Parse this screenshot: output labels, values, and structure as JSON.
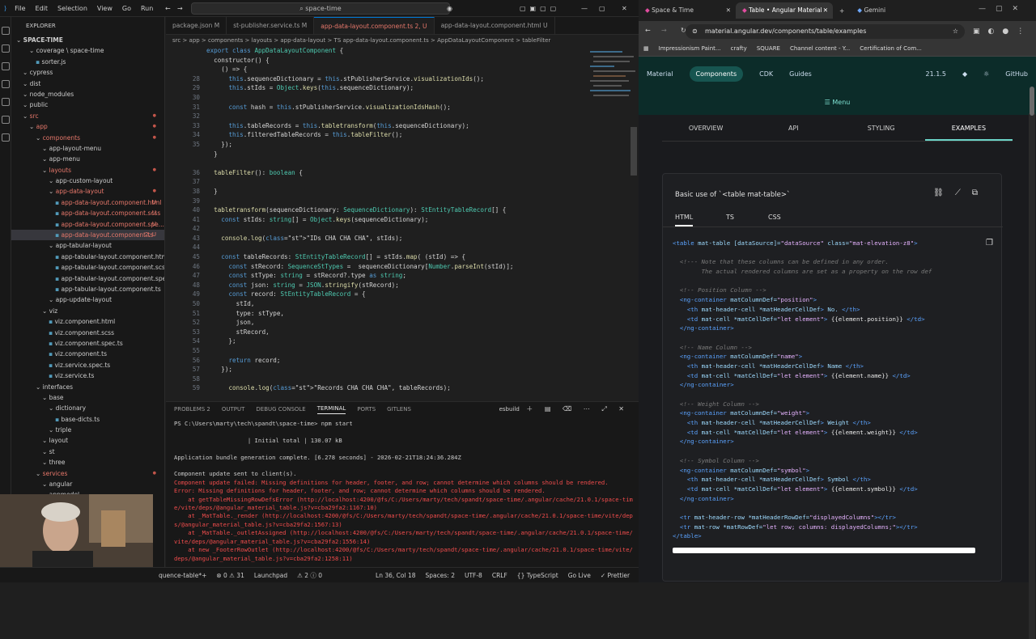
{
  "vscode": {
    "menu": [
      "File",
      "Edit",
      "Selection",
      "View",
      "Go",
      "Run"
    ],
    "search": "space-time",
    "explorer_title": "EXPLORER",
    "tree": [
      {
        "label": "SPACE-TIME",
        "indent": 0,
        "type": "root"
      },
      {
        "label": "coverage \\ space-time",
        "indent": 2,
        "type": "folder"
      },
      {
        "label": "sorter.js",
        "indent": 3,
        "type": "file"
      },
      {
        "label": "cypress",
        "indent": 1,
        "type": "folder"
      },
      {
        "label": "dist",
        "indent": 1,
        "type": "folder"
      },
      {
        "label": "node_modules",
        "indent": 1,
        "type": "folder"
      },
      {
        "label": "public",
        "indent": 1,
        "type": "folder"
      },
      {
        "label": "src",
        "indent": 1,
        "type": "folder",
        "color": "red"
      },
      {
        "label": "app",
        "indent": 2,
        "type": "folder",
        "color": "red"
      },
      {
        "label": "components",
        "indent": 3,
        "type": "folder",
        "color": "red"
      },
      {
        "label": "app-layout-menu",
        "indent": 4,
        "type": "folder"
      },
      {
        "label": "app-menu",
        "indent": 4,
        "type": "folder"
      },
      {
        "label": "layouts",
        "indent": 4,
        "type": "folder",
        "color": "red"
      },
      {
        "label": "app-custom-layout",
        "indent": 5,
        "type": "folder"
      },
      {
        "label": "app-data-layout",
        "indent": 5,
        "type": "folder",
        "color": "red"
      },
      {
        "label": "app-data-layout.component.html",
        "indent": 6,
        "type": "file",
        "color": "red",
        "badge": "U"
      },
      {
        "label": "app-data-layout.component.scss",
        "indent": 6,
        "type": "file",
        "color": "red",
        "badge": "U"
      },
      {
        "label": "app-data-layout.component.spe...",
        "indent": 6,
        "type": "file",
        "color": "red",
        "badge": "U"
      },
      {
        "label": "app-data-layout.component.ts",
        "indent": 6,
        "type": "file",
        "color": "red",
        "badge": "2, U",
        "selected": true
      },
      {
        "label": "app-tabular-layout",
        "indent": 5,
        "type": "folder"
      },
      {
        "label": "app-tabular-layout.component.html",
        "indent": 6,
        "type": "file"
      },
      {
        "label": "app-tabular-layout.component.scss",
        "indent": 6,
        "type": "file"
      },
      {
        "label": "app-tabular-layout.component.spec.ts",
        "indent": 6,
        "type": "file"
      },
      {
        "label": "app-tabular-layout.component.ts",
        "indent": 6,
        "type": "file"
      },
      {
        "label": "app-update-layout",
        "indent": 5,
        "type": "folder"
      },
      {
        "label": "viz",
        "indent": 4,
        "type": "folder"
      },
      {
        "label": "viz.component.html",
        "indent": 5,
        "type": "file"
      },
      {
        "label": "viz.component.scss",
        "indent": 5,
        "type": "file"
      },
      {
        "label": "viz.component.spec.ts",
        "indent": 5,
        "type": "file"
      },
      {
        "label": "viz.component.ts",
        "indent": 5,
        "type": "file"
      },
      {
        "label": "viz.service.spec.ts",
        "indent": 5,
        "type": "file"
      },
      {
        "label": "viz.service.ts",
        "indent": 5,
        "type": "file"
      },
      {
        "label": "interfaces",
        "indent": 3,
        "type": "folder"
      },
      {
        "label": "base",
        "indent": 4,
        "type": "folder"
      },
      {
        "label": "dictionary",
        "indent": 5,
        "type": "folder"
      },
      {
        "label": "base-dicts.ts",
        "indent": 6,
        "type": "file"
      },
      {
        "label": "triple",
        "indent": 5,
        "type": "folder"
      },
      {
        "label": "layout",
        "indent": 4,
        "type": "folder"
      },
      {
        "label": "st",
        "indent": 4,
        "type": "folder"
      },
      {
        "label": "three",
        "indent": 4,
        "type": "folder"
      },
      {
        "label": "services",
        "indent": 3,
        "type": "folder",
        "color": "red"
      },
      {
        "label": "angular",
        "indent": 4,
        "type": "folder"
      },
      {
        "label": "appmodel",
        "indent": 4,
        "type": "folder"
      }
    ],
    "tabs": [
      {
        "label": "package.json M",
        "active": false
      },
      {
        "label": "st-publisher.service.ts M",
        "active": false
      },
      {
        "label": "app-data-layout.component.ts 2, U",
        "active": true
      },
      {
        "label": "app-data-layout.component.html U",
        "active": false
      }
    ],
    "breadcrumb": "src > app > components > layouts > app-data-layout > TS app-data-layout.component.ts > AppDataLayoutComponent > tableFilter",
    "code": [
      {
        "n": "",
        "t": "export class AppDataLayoutComponent {"
      },
      {
        "n": "",
        "t": "  constructor() {"
      },
      {
        "n": "",
        "t": "    () => {"
      },
      {
        "n": "28",
        "t": "      this.sequenceDictionary = this.stPublisherService.visualizationIds();"
      },
      {
        "n": "29",
        "t": "      this.stIds = Object.keys(this.sequenceDictionary);"
      },
      {
        "n": "30",
        "t": ""
      },
      {
        "n": "31",
        "t": "      const hash = this.stPublisherService.visualizationIdsHash();"
      },
      {
        "n": "32",
        "t": ""
      },
      {
        "n": "33",
        "t": "      this.tableRecords = this.tabletransform(this.sequenceDictionary);"
      },
      {
        "n": "34",
        "t": "      this.filteredTableRecords = this.tableFilter();"
      },
      {
        "n": "35",
        "t": "    });"
      },
      {
        "n": "",
        "t": "  }"
      },
      {
        "n": "",
        "t": ""
      },
      {
        "n": "36",
        "t": "  tableFilter(): boolean {"
      },
      {
        "n": "37",
        "t": ""
      },
      {
        "n": "38",
        "t": "  }"
      },
      {
        "n": "39",
        "t": ""
      },
      {
        "n": "40",
        "t": "  tabletransform(sequenceDictionary: SequenceDictionary): StEntityTableRecord[] {"
      },
      {
        "n": "41",
        "t": "    const stIds: string[] = Object.keys(sequenceDictionary);"
      },
      {
        "n": "42",
        "t": ""
      },
      {
        "n": "43",
        "t": "    console.log(\"IDs CHA CHA CHA\", stIds);"
      },
      {
        "n": "44",
        "t": ""
      },
      {
        "n": "45",
        "t": "    const tableRecords: StEntityTableRecord[] = stIds.map( (stId) => {"
      },
      {
        "n": "46",
        "t": "      const stRecord: SequenceStTypes =  sequenceDictionary[Number.parseInt(stId)];"
      },
      {
        "n": "47",
        "t": "      const stType: string = stRecord?.type as string;"
      },
      {
        "n": "48",
        "t": "      const json: string = JSON.stringify(stRecord);"
      },
      {
        "n": "49",
        "t": "      const record: StEntityTableRecord = {"
      },
      {
        "n": "50",
        "t": "        stId,"
      },
      {
        "n": "51",
        "t": "        type: stType,"
      },
      {
        "n": "52",
        "t": "        json,"
      },
      {
        "n": "53",
        "t": "        stRecord,"
      },
      {
        "n": "54",
        "t": "      };"
      },
      {
        "n": "55",
        "t": ""
      },
      {
        "n": "56",
        "t": "      return record;"
      },
      {
        "n": "57",
        "t": "    });"
      },
      {
        "n": "58",
        "t": ""
      },
      {
        "n": "59",
        "t": "      console.log(\"Records CHA CHA CHA\", tableRecords);"
      }
    ],
    "panel_tabs": [
      "PROBLEMS 2",
      "OUTPUT",
      "DEBUG CONSOLE",
      "TERMINAL",
      "PORTS",
      "GITLENS"
    ],
    "panel_active": "TERMINAL",
    "terminal_name": "esbuild",
    "terminal": [
      {
        "t": "PS C:\\Users\\marty\\tech\\spandt\\space-time> npm start",
        "c": "norm"
      },
      {
        "t": "",
        "c": "norm"
      },
      {
        "t": "                     | Initial total | 130.07 kB",
        "c": "norm"
      },
      {
        "t": "",
        "c": "norm"
      },
      {
        "t": "Application bundle generation complete. [6.278 seconds] - 2026-02-21T18:24:36.284Z",
        "c": "norm"
      },
      {
        "t": "",
        "c": "norm"
      },
      {
        "t": "Component update sent to client(s).",
        "c": "norm"
      },
      {
        "t": "Component update failed: Missing definitions for header, footer, and row; cannot determine which columns should be rendered.",
        "c": "err"
      },
      {
        "t": "Error: Missing definitions for header, footer, and row; cannot determine which columns should be rendered.",
        "c": "err"
      },
      {
        "t": "    at getTableMissingRowDefsError (http://localhost:4200/@fs/C:/Users/marty/tech/spandt/space-time/.angular/cache/21.0.1/space-tim",
        "c": "err"
      },
      {
        "t": "e/vite/deps/@angular_material_table.js?v=cba29fa2:1167:10)",
        "c": "err"
      },
      {
        "t": "    at _MatTable._render (http://localhost:4200/@fs/C:/Users/marty/tech/spandt/space-time/.angular/cache/21.0.1/space-time/vite/dep",
        "c": "err"
      },
      {
        "t": "s/@angular_material_table.js?v=cba29fa2:1567:13)",
        "c": "err"
      },
      {
        "t": "    at _MatTable._outletAssigned (http://localhost:4200/@fs/C:/Users/marty/tech/spandt/space-time/.angular/cache/21.0.1/space-time/",
        "c": "err"
      },
      {
        "t": "vite/deps/@angular_material_table.js?v=cba29fa2:1556:14)",
        "c": "err"
      },
      {
        "t": "    at new _FooterRowOutlet (http://localhost:4200/@fs/C:/Users/marty/tech/spandt/space-time/.angular/cache/21.0.1/space-time/vite/",
        "c": "err"
      },
      {
        "t": "deps/@angular_material_table.js?v=cba29fa2:1258:11)",
        "c": "err"
      }
    ],
    "status": [
      "quence-table*+",
      "⊗ 0 ⚠ 31",
      "Launchpad",
      "⚠ 2 ⓘ 0",
      "Ln 36, Col 18",
      "Spaces: 2",
      "UTF-8",
      "CRLF",
      "{} TypeScript",
      "Go Live",
      "✓ Prettier"
    ]
  },
  "chrome": {
    "tabs": [
      {
        "label": "Space & Time",
        "active": false
      },
      {
        "label": "Table • Angular Material",
        "active": true
      },
      {
        "label": "Gemini",
        "active": false
      }
    ],
    "url": "material.angular.dev/components/table/examples",
    "bookmarks": [
      "Impressionism Paint...",
      "crafty",
      "SQUARE",
      "Channel content - Y...",
      "Certification of Com..."
    ],
    "site_nav": [
      "Material",
      "Components",
      "CDK",
      "Guides"
    ],
    "version": "21.1.5",
    "github": "GitHub",
    "menu": "Menu",
    "page_tabs": [
      "OVERVIEW",
      "API",
      "STYLING",
      "EXAMPLES"
    ],
    "page_tab_active": "EXAMPLES",
    "card_title": "Basic use of `<table mat-table>`",
    "code_tabs": [
      "HTML",
      "TS",
      "CSS"
    ],
    "code_tab_active": "HTML",
    "snippet": [
      "<table mat-table [dataSource]=\"dataSource\" class=\"mat-elevation-z8\">",
      "",
      "  <!--- Note that these columns can be defined in any order.",
      "        The actual rendered columns are set as a property on the row def",
      "",
      "  <!-- Position Column -->",
      "  <ng-container matColumnDef=\"position\">",
      "    <th mat-header-cell *matHeaderCellDef> No. </th>",
      "    <td mat-cell *matCellDef=\"let element\"> {{element.position}} </td>",
      "  </ng-container>",
      "",
      "  <!-- Name Column -->",
      "  <ng-container matColumnDef=\"name\">",
      "    <th mat-header-cell *matHeaderCellDef> Name </th>",
      "    <td mat-cell *matCellDef=\"let element\"> {{element.name}} </td>",
      "  </ng-container>",
      "",
      "  <!-- Weight Column -->",
      "  <ng-container matColumnDef=\"weight\">",
      "    <th mat-header-cell *matHeaderCellDef> Weight </th>",
      "    <td mat-cell *matCellDef=\"let element\"> {{element.weight}} </td>",
      "  </ng-container>",
      "",
      "  <!-- Symbol Column -->",
      "  <ng-container matColumnDef=\"symbol\">",
      "    <th mat-header-cell *matHeaderCellDef> Symbol </th>",
      "    <td mat-cell *matCellDef=\"let element\"> {{element.symbol}} </td>",
      "  </ng-container>",
      "",
      "  <tr mat-header-row *matHeaderRowDef=\"displayedColumns\"></tr>",
      "  <tr mat-row *matRowDef=\"let row; columns: displayedColumns;\"></tr>",
      "</table>"
    ]
  }
}
